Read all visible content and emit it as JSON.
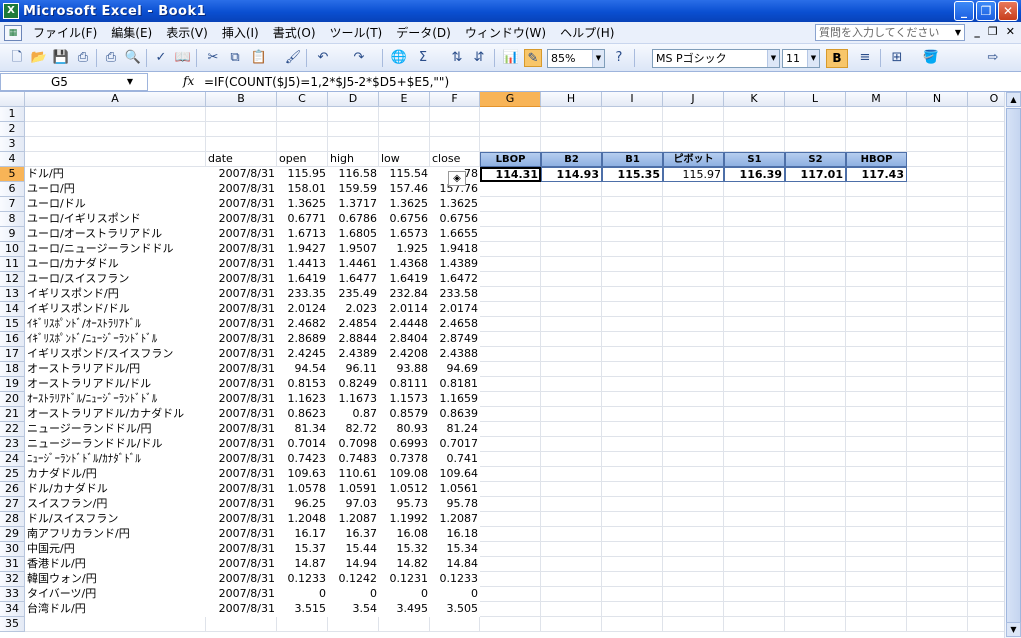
{
  "app": {
    "title": "Microsoft Excel - Book1",
    "icon": "excel-icon"
  },
  "window_buttons": {
    "minimize": "_",
    "restore": "❐",
    "close": "✕"
  },
  "menu": [
    "ファイル(F)",
    "編集(E)",
    "表示(V)",
    "挿入(I)",
    "書式(O)",
    "ツール(T)",
    "データ(D)",
    "ウィンドウ(W)",
    "ヘルプ(H)"
  ],
  "help_placeholder": "質問を入力してください",
  "toolbar": {
    "zoom": "85%",
    "font_name": "MS Pゴシック",
    "font_size": "11",
    "bold": "B"
  },
  "name_box": "G5",
  "formula": "=IF(COUNT($J5)=1,2*$J5-2*$D5+$E5,\"\")",
  "columns": [
    "A",
    "B",
    "C",
    "D",
    "E",
    "F",
    "G",
    "H",
    "I",
    "J",
    "K",
    "L",
    "M",
    "N",
    "O"
  ],
  "rows": [
    "1",
    "2",
    "3",
    "4",
    "5",
    "6",
    "7",
    "8",
    "9",
    "10",
    "11",
    "12",
    "13",
    "14",
    "15",
    "16",
    "17",
    "18",
    "19",
    "20",
    "21",
    "22",
    "23",
    "24",
    "25",
    "26",
    "27",
    "28",
    "29",
    "30",
    "31",
    "32",
    "33",
    "34",
    "35"
  ],
  "headers": {
    "date": "date",
    "open": "open",
    "high": "high",
    "low": "low",
    "close": "close"
  },
  "pivot_headers": [
    "LBOP",
    "B2",
    "B1",
    "ピボット",
    "S1",
    "S2",
    "HBOP"
  ],
  "pivot_values": [
    "114.31",
    "114.93",
    "115.35",
    "115.97",
    "116.39",
    "117.01",
    "117.43"
  ],
  "f5_partial": "78",
  "data": [
    [
      "ドル/円",
      "2007/8/31",
      "115.95",
      "116.58",
      "115.54",
      ""
    ],
    [
      "ユーロ/円",
      "2007/8/31",
      "158.01",
      "159.59",
      "157.46",
      "157.76"
    ],
    [
      "ユーロ/ドル",
      "2007/8/31",
      "1.3625",
      "1.3717",
      "1.3625",
      "1.3625"
    ],
    [
      "ユーロ/イギリスポンド",
      "2007/8/31",
      "0.6771",
      "0.6786",
      "0.6756",
      "0.6756"
    ],
    [
      "ユーロ/オーストラリアドル",
      "2007/8/31",
      "1.6713",
      "1.6805",
      "1.6573",
      "1.6655"
    ],
    [
      "ユーロ/ニュージーランドドル",
      "2007/8/31",
      "1.9427",
      "1.9507",
      "1.925",
      "1.9418"
    ],
    [
      "ユーロ/カナダドル",
      "2007/8/31",
      "1.4413",
      "1.4461",
      "1.4368",
      "1.4389"
    ],
    [
      "ユーロ/スイスフラン",
      "2007/8/31",
      "1.6419",
      "1.6477",
      "1.6419",
      "1.6472"
    ],
    [
      "イギリスポンド/円",
      "2007/8/31",
      "233.35",
      "235.49",
      "232.84",
      "233.58"
    ],
    [
      "イギリスポンド/ドル",
      "2007/8/31",
      "2.0124",
      "2.023",
      "2.0114",
      "2.0174"
    ],
    [
      "ｲｷﾞﾘｽﾎﾟﾝﾄﾞ/ｵｰｽﾄﾗﾘｱﾄﾞﾙ",
      "2007/8/31",
      "2.4682",
      "2.4854",
      "2.4448",
      "2.4658"
    ],
    [
      "ｲｷﾞﾘｽﾎﾟﾝﾄﾞ/ﾆｭｰｼﾞｰﾗﾝﾄﾞﾄﾞﾙ",
      "2007/8/31",
      "2.8689",
      "2.8844",
      "2.8404",
      "2.8749"
    ],
    [
      "イギリスポンド/スイスフラン",
      "2007/8/31",
      "2.4245",
      "2.4389",
      "2.4208",
      "2.4388"
    ],
    [
      "オーストラリアドル/円",
      "2007/8/31",
      "94.54",
      "96.11",
      "93.88",
      "94.69"
    ],
    [
      "オーストラリアドル/ドル",
      "2007/8/31",
      "0.8153",
      "0.8249",
      "0.8111",
      "0.8181"
    ],
    [
      "ｵｰｽﾄﾗﾘｱﾄﾞﾙ/ﾆｭｰｼﾞｰﾗﾝﾄﾞﾄﾞﾙ",
      "2007/8/31",
      "1.1623",
      "1.1673",
      "1.1573",
      "1.1659"
    ],
    [
      "オーストラリアドル/カナダドル",
      "2007/8/31",
      "0.8623",
      "0.87",
      "0.8579",
      "0.8639"
    ],
    [
      "ニュージーランドドル/円",
      "2007/8/31",
      "81.34",
      "82.72",
      "80.93",
      "81.24"
    ],
    [
      "ニュージーランドドル/ドル",
      "2007/8/31",
      "0.7014",
      "0.7098",
      "0.6993",
      "0.7017"
    ],
    [
      "ﾆｭｰｼﾞｰﾗﾝﾄﾞﾄﾞﾙ/ｶﾅﾀﾞﾄﾞﾙ",
      "2007/8/31",
      "0.7423",
      "0.7483",
      "0.7378",
      "0.741"
    ],
    [
      "カナダドル/円",
      "2007/8/31",
      "109.63",
      "110.61",
      "109.08",
      "109.64"
    ],
    [
      "ドル/カナダドル",
      "2007/8/31",
      "1.0578",
      "1.0591",
      "1.0512",
      "1.0561"
    ],
    [
      "スイスフラン/円",
      "2007/8/31",
      "96.25",
      "97.03",
      "95.73",
      "95.78"
    ],
    [
      "ドル/スイスフラン",
      "2007/8/31",
      "1.2048",
      "1.2087",
      "1.1992",
      "1.2087"
    ],
    [
      "南アフリカランド/円",
      "2007/8/31",
      "16.17",
      "16.37",
      "16.08",
      "16.18"
    ],
    [
      "中国元/円",
      "2007/8/31",
      "15.37",
      "15.44",
      "15.32",
      "15.34"
    ],
    [
      "香港ドル/円",
      "2007/8/31",
      "14.87",
      "14.94",
      "14.82",
      "14.84"
    ],
    [
      "韓国ウォン/円",
      "2007/8/31",
      "0.1233",
      "0.1242",
      "0.1231",
      "0.1233"
    ],
    [
      "タイバーツ/円",
      "2007/8/31",
      "0",
      "0",
      "0",
      "0"
    ],
    [
      "台湾ドル/円",
      "2007/8/31",
      "3.515",
      "3.54",
      "3.495",
      "3.505"
    ]
  ],
  "colors": {
    "title_bar": "#0a4fd1",
    "active_header": "#f8b457",
    "pivot_header": "#8eb0e2"
  }
}
